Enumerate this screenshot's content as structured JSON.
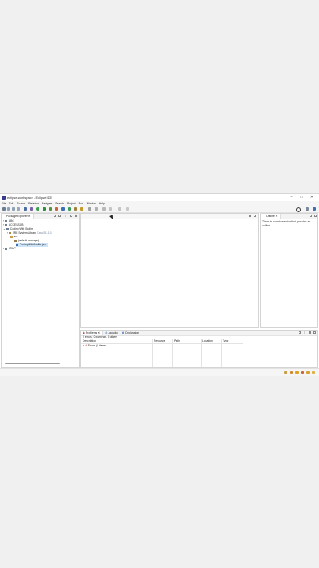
{
  "window": {
    "title": "eclipse-workspace - Eclipse IDE",
    "minimize": "–",
    "maximize": "□",
    "close": "✕"
  },
  "menu": [
    "File",
    "Edit",
    "Source",
    "Refactor",
    "Navigate",
    "Search",
    "Project",
    "Run",
    "Window",
    "Help"
  ],
  "package_explorer": {
    "tab": "Package Explorer",
    "tree": [
      {
        "label": "ABC",
        "level": 0,
        "icon": "project-icon"
      },
      {
        "label": "ACCESSDB",
        "level": 0,
        "icon": "project-icon"
      },
      {
        "label": "Coding With Sudhir",
        "level": 0,
        "icon": "project-icon"
      },
      {
        "label": "JRE System Library",
        "suffix": "[JavaSE-13]",
        "level": 1,
        "icon": "library-icon"
      },
      {
        "label": "src",
        "level": 1,
        "icon": "source-folder-icon"
      },
      {
        "label": "(default package)",
        "level": 2,
        "icon": "package-icon"
      },
      {
        "label": "CodingWithSudhir.java",
        "level": 3,
        "icon": "java-file-icon",
        "selected": true
      },
      {
        "label": "JDBC",
        "level": 0,
        "icon": "project-icon"
      }
    ]
  },
  "outline": {
    "tab": "Outline",
    "message": "There is no active editor that provides an outline."
  },
  "bottom": {
    "tabs": [
      "Problems",
      "Javadoc",
      "Declaration"
    ],
    "summary": "0 errors, 0 warnings, 0 others",
    "columns": [
      "Description",
      "Resource",
      "Path",
      "Location",
      "Type"
    ],
    "rows": [
      {
        "description": "Errors (0 items)"
      }
    ]
  },
  "colors": {
    "accent": "#3b6fb6",
    "selection": "#cde3f7",
    "error": "#d0392b"
  }
}
